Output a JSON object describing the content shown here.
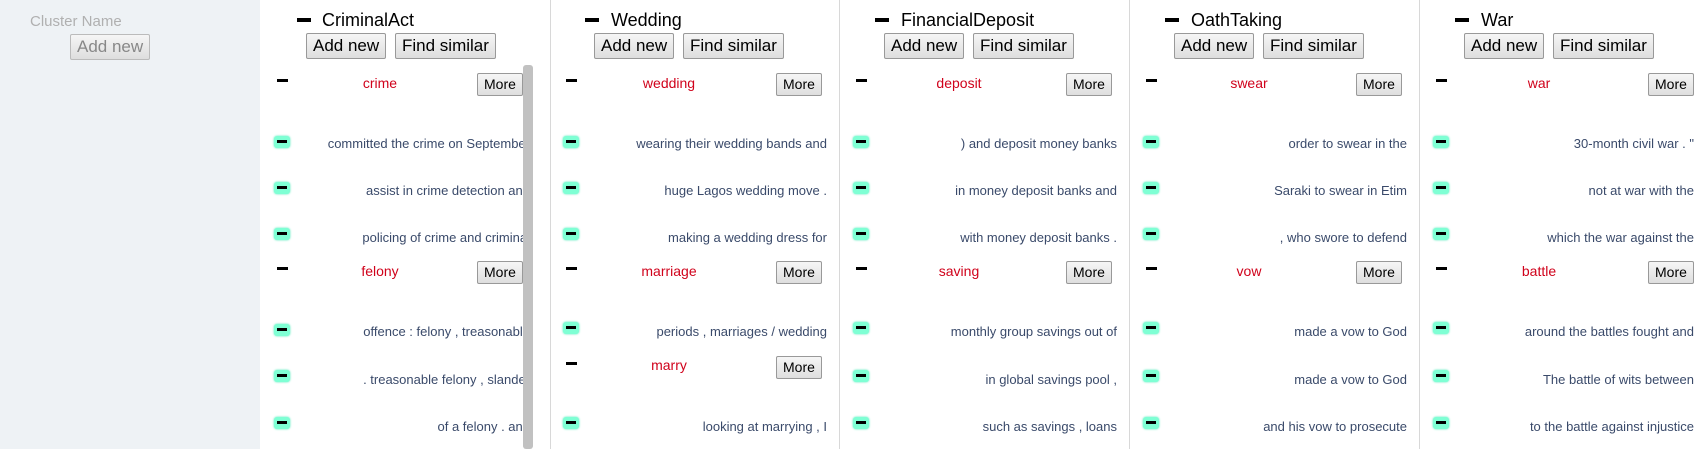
{
  "left_panel": {
    "cluster_name_placeholder": "Cluster Name",
    "add_new_label": "Add new"
  },
  "columns": [
    {
      "title": "CriminalAct",
      "add_new": "Add new",
      "find_similar": "Find similar",
      "keywords": [
        {
          "label": "crime",
          "more": "More",
          "snippets": [
            "committed the crime on September",
            "assist in crime detection and",
            "policing of crime and criminal"
          ]
        },
        {
          "label": "felony",
          "more": "More",
          "snippets": [
            "offence : felony , treasonable",
            ". treasonable felony , slander",
            "of a felony . and"
          ]
        }
      ]
    },
    {
      "title": "Wedding",
      "add_new": "Add new",
      "find_similar": "Find similar",
      "keywords": [
        {
          "label": "wedding",
          "more": "More",
          "snippets": [
            "wearing their wedding bands and",
            "huge Lagos wedding move .",
            "making a wedding dress for"
          ]
        },
        {
          "label": "marriage",
          "more": "More",
          "snippets": [
            "periods , marriages / wedding"
          ]
        },
        {
          "label": "marry",
          "more": "More",
          "snippets": [
            "looking at marrying , I"
          ]
        }
      ]
    },
    {
      "title": "FinancialDeposit",
      "add_new": "Add new",
      "find_similar": "Find similar",
      "keywords": [
        {
          "label": "deposit",
          "more": "More",
          "snippets": [
            ") and deposit money banks",
            "in money deposit banks and",
            "with money deposit banks ."
          ]
        },
        {
          "label": "saving",
          "more": "More",
          "snippets": [
            "monthly group savings out of",
            "in global savings pool ,",
            "such as savings , loans"
          ]
        }
      ]
    },
    {
      "title": "OathTaking",
      "add_new": "Add new",
      "find_similar": "Find similar",
      "keywords": [
        {
          "label": "swear",
          "more": "More",
          "snippets": [
            "order to swear in the",
            "Saraki to swear in Etim",
            ", who swore to defend"
          ]
        },
        {
          "label": "vow",
          "more": "More",
          "snippets": [
            "made a vow to God",
            "made a vow to God",
            "and his vow to prosecute"
          ]
        }
      ]
    },
    {
      "title": "War",
      "add_new": "Add new",
      "find_similar": "Find similar",
      "keywords": [
        {
          "label": "war",
          "more": "More",
          "snippets": [
            "30-month civil war . \"",
            "not at war with the",
            "which the war against the"
          ]
        },
        {
          "label": "battle",
          "more": "More",
          "snippets": [
            "around the battles fought and",
            "The battle of wits between",
            "to the battle against injustice"
          ]
        }
      ]
    }
  ]
}
